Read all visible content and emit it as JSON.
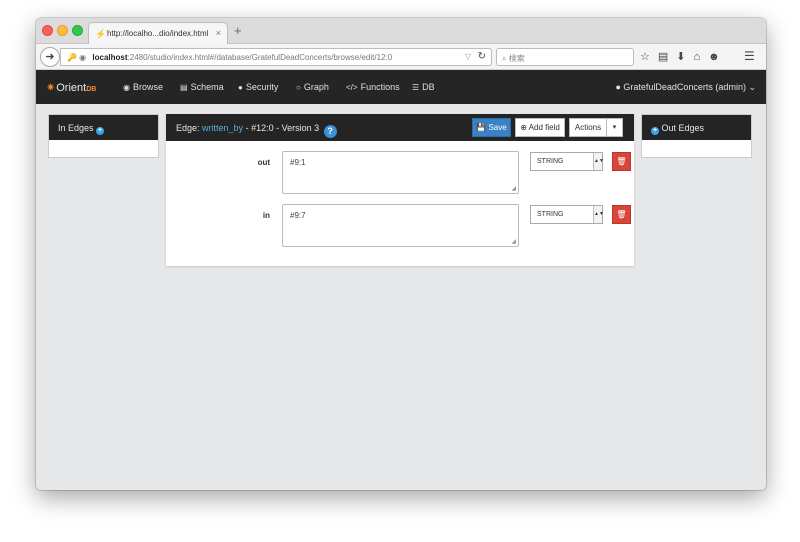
{
  "browser": {
    "tab_title": "http://localho...dio/index.html",
    "tab_close": "×",
    "new_tab": "+",
    "url_host": "localhost",
    "url_rest": ":2480/studio/index.html#/database/GratefulDeadConcerts/browse/edit/12:0",
    "search_placeholder": "検索"
  },
  "app": {
    "logo_text": "Orient",
    "logo_suffix": "DB",
    "nav": [
      {
        "label": "Browse"
      },
      {
        "label": "Schema"
      },
      {
        "label": "Security"
      },
      {
        "label": "Graph"
      },
      {
        "label": "Functions"
      },
      {
        "label": "DB"
      }
    ],
    "user": "GratefulDeadConcerts (admin)"
  },
  "left_panel": {
    "title": "In Edges"
  },
  "right_panel": {
    "title": "Out Edges"
  },
  "edge": {
    "prefix": "Edge:",
    "class_name": "written_by",
    "suffix": "- #12:0 - Version 3",
    "help": "?",
    "save_label": "Save",
    "add_field_label": "Add field",
    "actions_label": "Actions",
    "fields": [
      {
        "name": "out",
        "value": "#9:1",
        "type": "STRING"
      },
      {
        "name": "in",
        "value": "#9:7",
        "type": "STRING"
      }
    ]
  }
}
